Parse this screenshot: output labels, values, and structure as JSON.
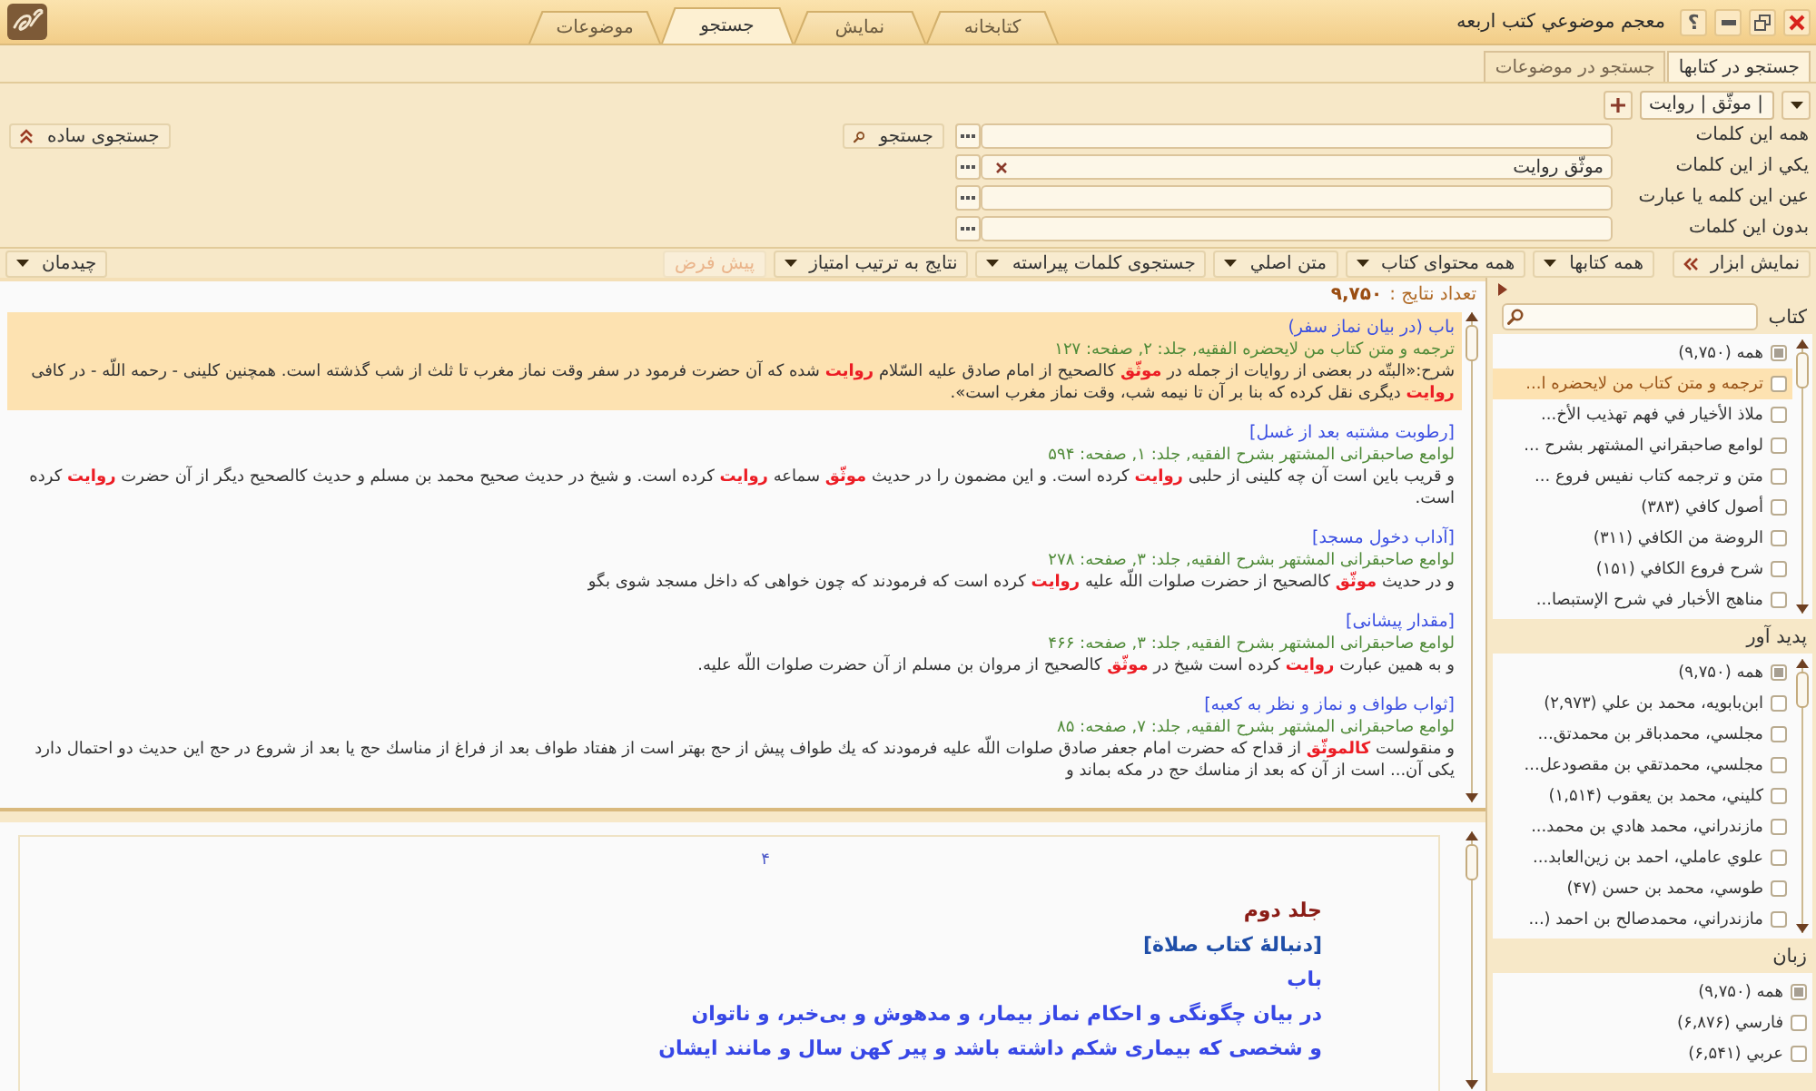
{
  "window": {
    "title": "معجم موضوعي كتب اربعه",
    "help_button": "؟"
  },
  "main_tabs": [
    {
      "label": "كتابخانه",
      "selected": false
    },
    {
      "label": "نمايش",
      "selected": false
    },
    {
      "label": "جستجو",
      "selected": true
    },
    {
      "label": "موضوعات",
      "selected": false
    }
  ],
  "search_tabs": [
    {
      "label": "جستجو در كتابها",
      "selected": true
    },
    {
      "label": "جستجو در موضوعات",
      "selected": false
    }
  ],
  "query_tabs": [
    {
      "label": "| موثّق | روايت",
      "selected": true
    }
  ],
  "search_form": {
    "rows": [
      {
        "label": "همه اين كلمات"
      },
      {
        "label": "يكي از اين كلمات",
        "value": "موثّق روايت"
      },
      {
        "label": "عين اين كلمه يا عبارت"
      },
      {
        "label": "بدون اين كلمات"
      }
    ],
    "search_button": "جستجو",
    "simple_search_button": "جستجوی ساده"
  },
  "toolbar": {
    "show_tools_button": "نمايش ابزار",
    "dropdowns": [
      "همه كتابها",
      "همه محتوای كتاب",
      "متن اصلي",
      "جستجوی كلمات پيراسته",
      "نتايج به ترتيب امتياز"
    ],
    "default_button": {
      "label": "پيش فرض",
      "disabled": true
    },
    "layout_button": "چيدمان"
  },
  "results": {
    "count_label": "تعداد نتايج :",
    "count": "۹,۷۵۰",
    "items": [
      {
        "title": "باب (در بيان نماز سفر)",
        "source": "ترجمه و متن كتاب من لايحضره الفقيه, جلد: ۲, صفحه: ۱۲۷",
        "snippet": "شرح:«البتّه در بعضى از روايات از جمله در **موثّق** كالصحيح از امام صادق عليه السّلام **روايت** شده كه آن حضرت فرمود در سفر وقت نماز مغرب تا ثلث از شب گذشته است. همچنين كلينى - رحمه اللّه - در كافى **روايت** ديگرى نقل كرده كه بنا بر آن تا نيمه شب، وقت نماز مغرب است».",
        "selected": true
      },
      {
        "title": "[رطوبت مشتبه بعد از غسل]",
        "source": "لوامع صاحبقرانى المشتهر بشرح الفقيه, جلد: ۱, صفحه: ۵۹۴",
        "snippet": "و قريب باين است آن چه كلينى از حلبى **روايت** كرده است. و اين مضمون را در حديث **موثّق** سماعه **روايت** كرده است. و شيخ در حديث صحيح محمد بن مسلم و حديث كالصحيح ديگر از آن حضرت **روايت** كرده است.",
        "selected": false
      },
      {
        "title": "[آداب دخول مسجد]",
        "source": "لوامع صاحبقرانى المشتهر بشرح الفقيه, جلد: ۳, صفحه: ۲۷۸",
        "snippet": "و در حديث **موثّق** كالصحيح از حضرت صلوات اللّه عليه **روايت** كرده است كه فرمودند كه چون خواهى كه داخل مسجد شوى بگو",
        "selected": false
      },
      {
        "title": "[مقدار پيشانى]",
        "source": "لوامع صاحبقرانى المشتهر بشرح الفقيه, جلد: ۳, صفحه: ۴۶۶",
        "snippet": "و به همين عبارت **روايت** كرده است شيخ در **موثّق** كالصحيح از مروان بن مسلم از آن حضرت صلوات اللّه عليه.",
        "selected": false
      },
      {
        "title": "[ثواب طواف و نماز و نظر به كعبه]",
        "source": "لوامع صاحبقرانى المشتهر بشرح الفقيه, جلد: ۷, صفحه: ۸۵",
        "snippet": "و منقولست **كالموثّق** از قداح كه حضرت امام جعفر صادق صلوات اللّه عليه فرمودند كه يك طواف پيش از حج بهتر است از هفتاد طواف بعد از فراغ از مناسك حج يا بعد از شروع در حج اين حديث دو احتمال دارد يكى آن... است از آن كه بعد از مناسك حج در مكه بماند و",
        "selected": false
      }
    ]
  },
  "preview": {
    "page_number": "۴",
    "lines": [
      {
        "kind": "volume",
        "text": "جلد دوم"
      },
      {
        "kind": "section",
        "text": "[دنبالهٔ كتاب صلاة]"
      },
      {
        "kind": "heading",
        "text": "باب"
      },
      {
        "kind": "heading",
        "text": "در بيان چگونگى و احكام نماز بيمار، و مدهوش و بى‌خبر، و ناتوان"
      },
      {
        "kind": "heading",
        "text": "و شخصى كه بيمارى شكم داشته باشد و پير كهن سال و مانند ايشان"
      }
    ]
  },
  "facets": [
    {
      "label": "كتاب",
      "searchable": true,
      "items": [
        {
          "label": "همه (۹,۷۵۰)",
          "checked": true,
          "selected": false
        },
        {
          "label": "ترجمه و متن كتاب من لايحضره ا...",
          "checked": false,
          "selected": true
        },
        {
          "label": "ملاذ الأخيار في فهم تهذيب الأخ...",
          "checked": false,
          "selected": false
        },
        {
          "label": "لوامع صاحبقراني المشتهر بشرح ...",
          "checked": false,
          "selected": false
        },
        {
          "label": "متن و ترجمه كتاب نفيس فروع ...",
          "checked": false,
          "selected": false
        },
        {
          "label": "أصول كافي (۳۸۳)",
          "checked": false,
          "selected": false
        },
        {
          "label": "الروضة من الكافي (۳۱۱)",
          "checked": false,
          "selected": false
        },
        {
          "label": "شرح فروع الكافي (۱۵۱)",
          "checked": false,
          "selected": false
        },
        {
          "label": "مناهج الأخبار في شرح الإستبصا...",
          "checked": false,
          "selected": false
        }
      ]
    },
    {
      "label": "پديد آور",
      "items": [
        {
          "label": "همه (۹,۷۵۰)",
          "checked": true,
          "selected": false
        },
        {
          "label": "ابن‌بابويه، محمد بن علي (۲,۹۷۳)",
          "checked": false,
          "selected": false
        },
        {
          "label": "مجلسي، محمدباقر بن محمدتق...",
          "checked": false,
          "selected": false
        },
        {
          "label": "مجلسي، محمدتقي بن مقصودعل...",
          "checked": false,
          "selected": false
        },
        {
          "label": "كليني، محمد بن يعقوب (۱,۵۱۴)",
          "checked": false,
          "selected": false
        },
        {
          "label": "مازندراني، محمد هادي بن محمد...",
          "checked": false,
          "selected": false
        },
        {
          "label": "علوي عاملي، احمد بن زين‌العابد...",
          "checked": false,
          "selected": false
        },
        {
          "label": "طوسي، محمد بن حسن (۴۷)",
          "checked": false,
          "selected": false
        },
        {
          "label": "مازندراني، محمدصالح بن احمد (...",
          "checked": false,
          "selected": false
        }
      ]
    },
    {
      "label": "زبان",
      "items": [
        {
          "label": "همه (۹,۷۵۰)",
          "checked": true,
          "selected": false
        },
        {
          "label": "فارسي (۶,۸۷۶)",
          "checked": false,
          "selected": false
        },
        {
          "label": "عربي (۶,۵۴۱)",
          "checked": false,
          "selected": false
        }
      ]
    }
  ]
}
